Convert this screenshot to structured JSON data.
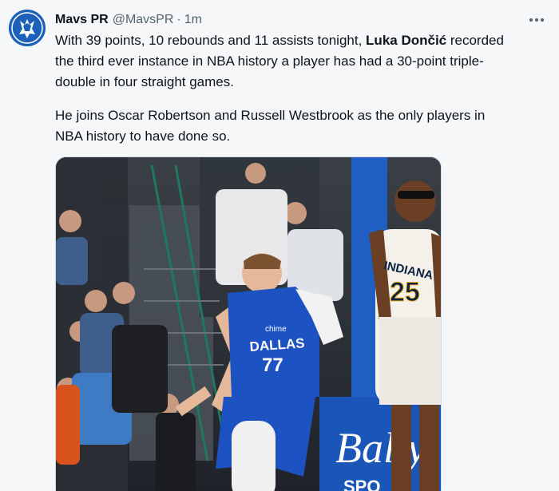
{
  "author": {
    "display_name": "Mavs PR",
    "handle": "@MavsPR",
    "separator": "·",
    "time": "1m",
    "avatar_icon": "mavericks-logo-icon"
  },
  "more_icon": "more-options-icon",
  "tweet": {
    "line1_pre": "With 39 points, 10 rebounds and 11 assists tonight, ",
    "line1_bold": "Luka Dončić",
    "line1_post": " recorded",
    "line2": "the third ever instance in NBA history a player has had a 30-point triple-",
    "line3": "double in four straight games.",
    "line4": "He joins Oscar Robertson and Russell Westbrook as the only players in",
    "line5": "NBA history to have done so."
  },
  "photo": {
    "jersey_team": "DALLAS",
    "jersey_number": "77",
    "jersey_sponsor": "chime",
    "opponent_team": "INDIANA",
    "opponent_number": "25",
    "sign_text": "Bally",
    "sign_sub": "SPO"
  },
  "colors": {
    "text": "#0f1419",
    "muted": "#536471",
    "mavs_blue": "#1c60b8",
    "pacers_gold": "#fdbb30"
  }
}
